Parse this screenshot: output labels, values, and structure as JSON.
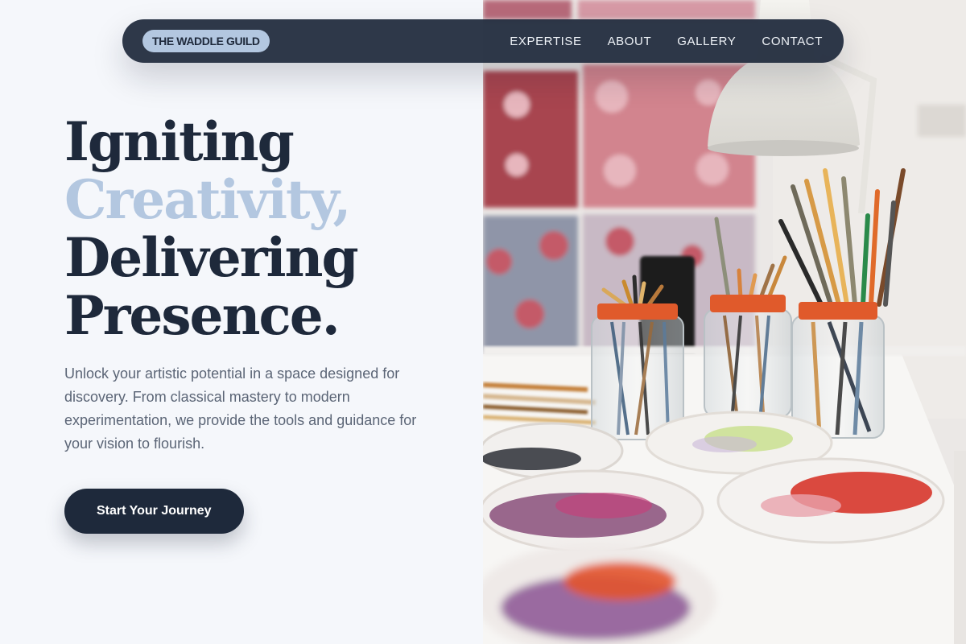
{
  "brand": {
    "logo_text": "THE WADDLE GUILD"
  },
  "nav": {
    "items": [
      {
        "label": "EXPERTISE"
      },
      {
        "label": "ABOUT"
      },
      {
        "label": "GALLERY"
      },
      {
        "label": "CONTACT"
      }
    ]
  },
  "hero": {
    "headline": {
      "line1": "Igniting",
      "line2": "Creativity,",
      "line3": "Delivering",
      "line4": "Presence."
    },
    "subtext": "Unlock your artistic potential in a space designed for discovery. From classical mastery to modern experimentation, we provide the tools and guidance for your vision to flourish.",
    "cta_label": "Start Your Journey"
  },
  "colors": {
    "navy": "#1e293b",
    "accent_blue": "#b3c7e0",
    "page_background": "#f5f7fb",
    "body_text": "#5b6576"
  }
}
